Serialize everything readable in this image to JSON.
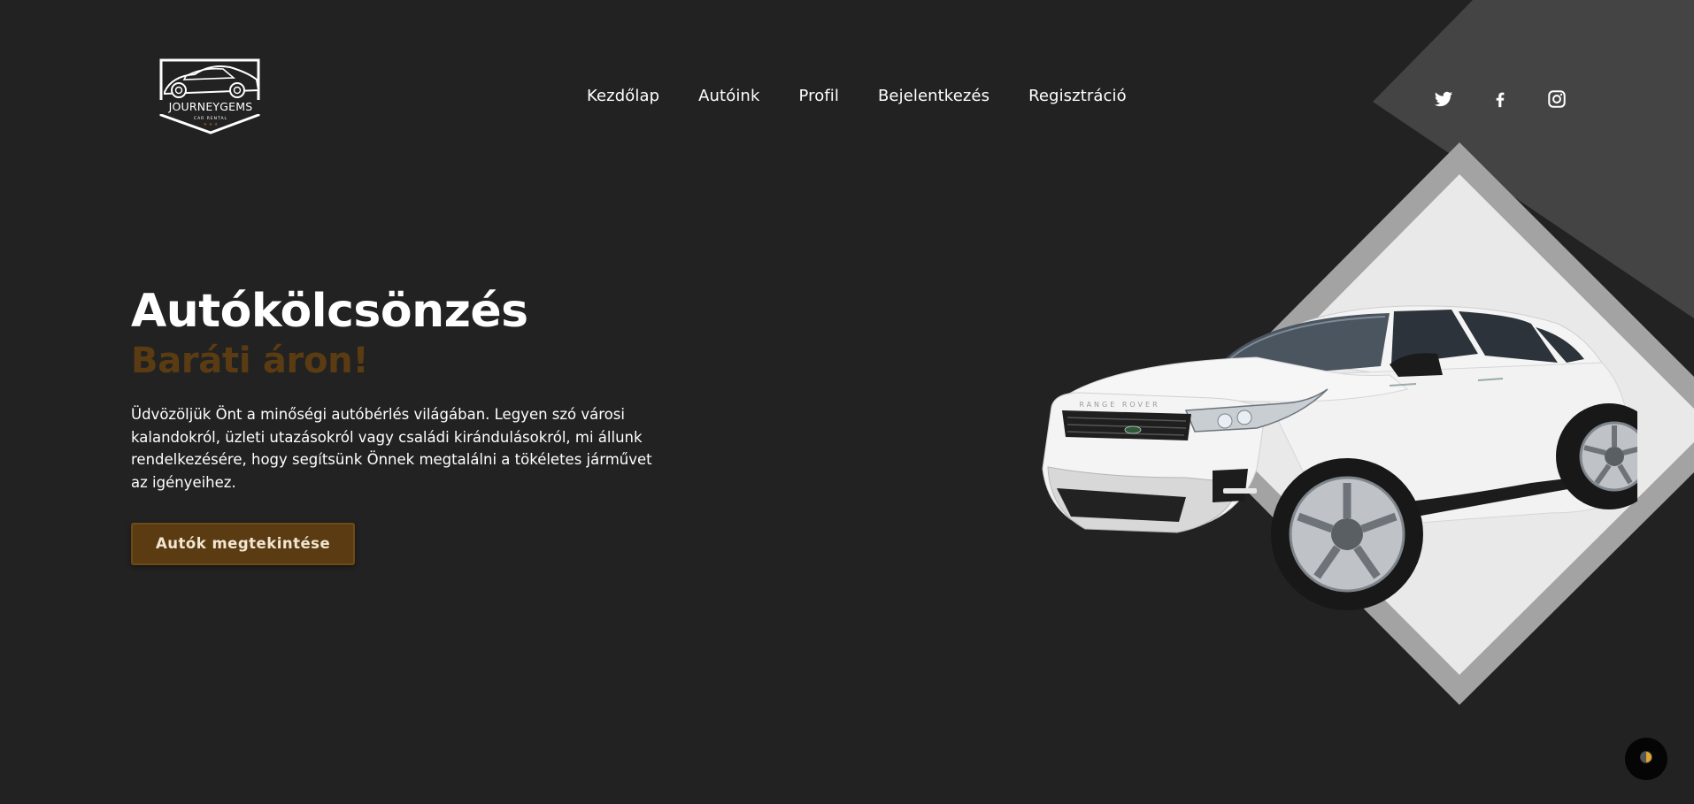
{
  "brand": {
    "name": "JOURNEYGEMS",
    "tagline": "CAR RENTAL"
  },
  "nav": {
    "items": [
      {
        "label": "Kezdőlap"
      },
      {
        "label": "Autóink"
      },
      {
        "label": "Profil"
      },
      {
        "label": "Bejelentkezés"
      },
      {
        "label": "Regisztráció"
      }
    ]
  },
  "social": {
    "icons": [
      "twitter-icon",
      "facebook-icon",
      "instagram-icon"
    ]
  },
  "hero": {
    "title": "Autókölcsönzés",
    "subtitle": "Baráti áron!",
    "description": "Üdvözöljük Önt a minőségi autóbérlés világában. Legyen szó városi kalandokról, üzleti utazásokról vagy családi kirándulásokról, mi állunk rendelkezésére, hogy segítsünk Önnek megtalálni a tökéletes járművet az igényeihez.",
    "cta_label": "Autók megtekintése"
  },
  "car": {
    "grille_text": "RANGE ROVER"
  },
  "theme_toggle": {
    "icon": "half-moon-icon"
  },
  "colors": {
    "background": "#222222",
    "accent": "#5b3c12",
    "diamond_outer": "#a3a3a3",
    "diamond_inner": "#e9e9e9",
    "corner_panel": "#444444"
  }
}
